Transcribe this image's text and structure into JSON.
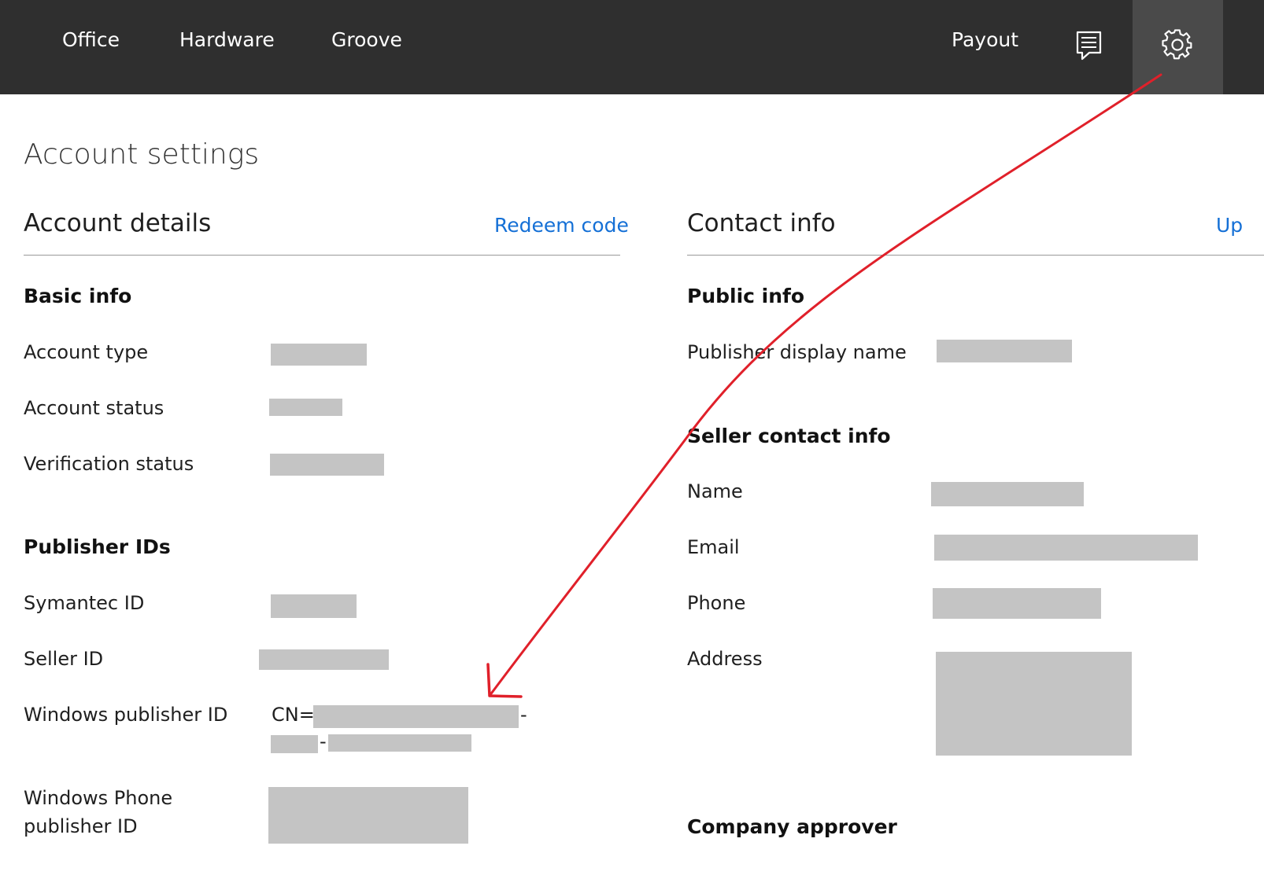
{
  "nav": {
    "office": "Office",
    "hardware": "Hardware",
    "groove": "Groove",
    "payout": "Payout"
  },
  "icons": {
    "message": "message-icon",
    "settings": "gear-icon"
  },
  "page_title": "Account settings",
  "account_details": {
    "title": "Account details",
    "redeem_link": "Redeem code",
    "basic_info": {
      "heading": "Basic info",
      "account_type": "Account type",
      "account_status": "Account status",
      "verification_status": "Verification status"
    },
    "publisher_ids": {
      "heading": "Publisher IDs",
      "symantec_id": "Symantec ID",
      "seller_id": "Seller ID",
      "windows_publisher_id": "Windows publisher ID",
      "windows_publisher_prefix": "CN=",
      "dash": "-",
      "windows_phone_line1": "Windows Phone",
      "windows_phone_line2": "publisher ID"
    }
  },
  "contact_info": {
    "title": "Contact info",
    "update_link": "Up",
    "public_info": {
      "heading": "Public info",
      "publisher_display_name": "Publisher display name"
    },
    "seller_contact_info": {
      "heading": "Seller contact info",
      "name": "Name",
      "email": "Email",
      "phone": "Phone",
      "address": "Address"
    },
    "company_approver": "Company approver"
  },
  "colors": {
    "topbar": "#2f2f2f",
    "gear_active": "#4a4a4a",
    "link": "#1570d6",
    "redaction": "#c4c4c4",
    "annotation_arrow": "#e0202a"
  }
}
